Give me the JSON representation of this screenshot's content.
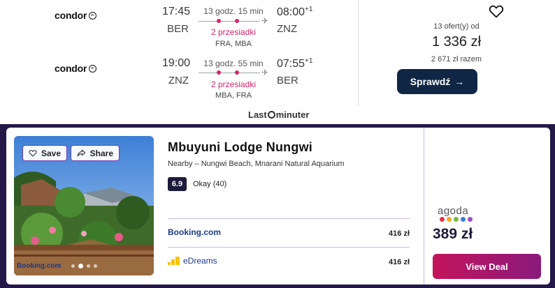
{
  "flight": {
    "outbound": {
      "airline": "condor",
      "departure_time": "17:45",
      "departure_code": "BER",
      "duration": "13 godz. 15 min",
      "stops": "2 przesiadki",
      "via": "FRA, MBA",
      "arrival_time": "08:00",
      "arrival_day_offset": "+1",
      "arrival_code": "ZNZ"
    },
    "inbound": {
      "airline": "condor",
      "departure_time": "19:00",
      "departure_code": "ZNZ",
      "duration": "13 godz. 55 min",
      "stops": "2 przesiadki",
      "via": "MBA, FRA",
      "arrival_time": "07:55",
      "arrival_day_offset": "+1",
      "arrival_code": "BER"
    },
    "offers_count": "13 ofert(y) od",
    "price": "1 336 zł",
    "total": "2 671 zł razem",
    "check_button": "Sprawdź",
    "provider_pre": "Last",
    "provider_post": "minuter"
  },
  "hotel": {
    "save_label": "Save",
    "share_label": "Share",
    "photo_brand": "Booking.com",
    "name": "Mbuyuni Lodge Nungwi",
    "nearby": "Nearby – Nungwi Beach, Mnarani Natural Aquarium",
    "rating_score": "6.9",
    "rating_text": "Okay (40)",
    "deals": [
      {
        "provider": "Booking.com",
        "price": "416 zł"
      },
      {
        "provider": "eDreams",
        "price": "416 zł"
      }
    ],
    "best_provider": "agoda",
    "best_price": "389 zł",
    "view_deal": "View Deal"
  },
  "colors": {
    "accent_pink": "#d8236b",
    "button_navy": "#0f2744",
    "panel_purple": "#231848",
    "view_deal_gradient": [
      "#c4145c",
      "#8a1a7c"
    ]
  }
}
